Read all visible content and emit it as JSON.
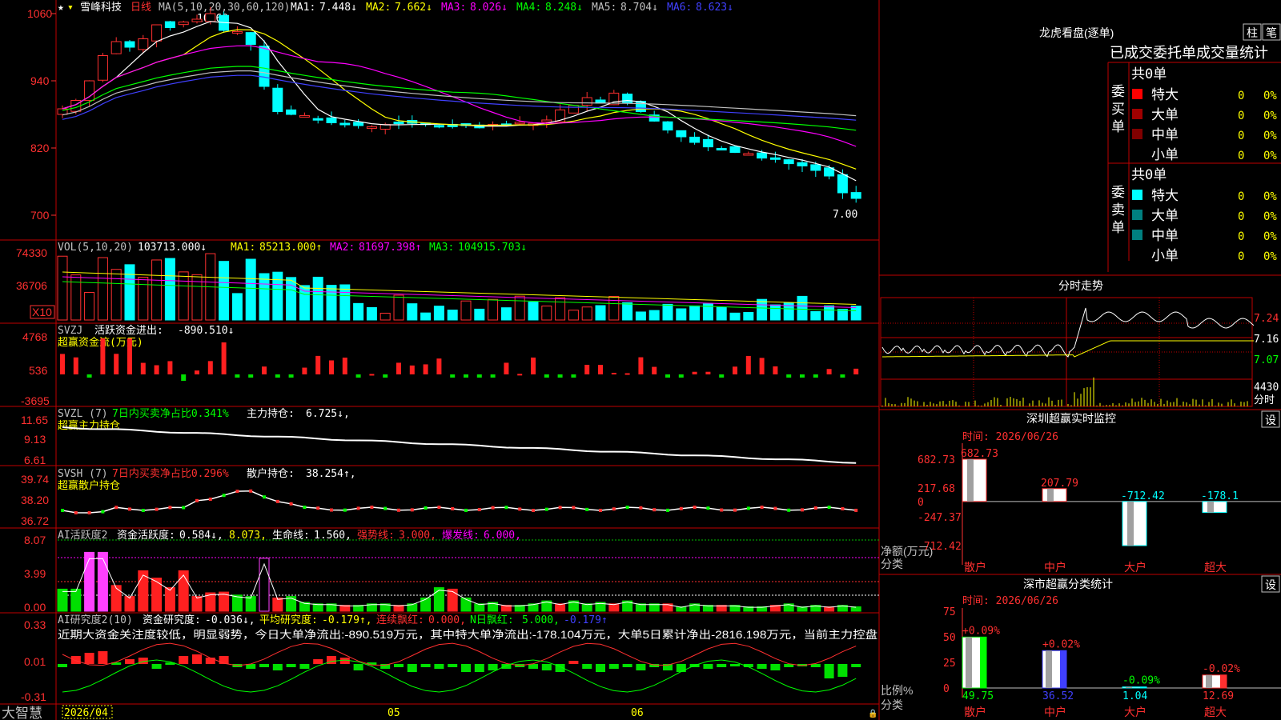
{
  "app": {
    "name": "大智慧",
    "date_label": "2026/04",
    "month_labels": [
      "05",
      "06"
    ]
  },
  "stock": {
    "name": "雪峰科技",
    "period": "日线",
    "high_marker": "10.60",
    "low_marker": "7.00",
    "ma_header": "MA(5,10,20,30,60,120)",
    "ma": [
      {
        "label": "MA1:",
        "value": "7.448↓",
        "color": "#ffffff"
      },
      {
        "label": "MA2:",
        "value": "7.662↓",
        "color": "#ffff00"
      },
      {
        "label": "MA3:",
        "value": "8.026↓",
        "color": "#ff00ff"
      },
      {
        "label": "MA4:",
        "value": "8.248↓",
        "color": "#00ff00"
      },
      {
        "label": "MA5:",
        "value": "8.704↓",
        "color": "#c0c0c0"
      },
      {
        "label": "MA6:",
        "value": "8.623↓",
        "color": "#4040ff"
      }
    ],
    "price_axis": [
      "1060",
      "940",
      "820",
      "700"
    ]
  },
  "vol": {
    "header": "VOL(5,10,20)",
    "value": "103713.000↓",
    "ma": [
      {
        "label": "MA1:",
        "value": "85213.000↑",
        "color": "#ffff00"
      },
      {
        "label": "MA2:",
        "value": "81697.398↑",
        "color": "#ff00ff"
      },
      {
        "label": "MA3:",
        "value": "104915.703↓",
        "color": "#00ff00"
      }
    ],
    "axis": [
      "74330",
      "36706"
    ],
    "unit": "X10"
  },
  "svzj": {
    "header": "SVZJ",
    "text": "活跃资金进出:",
    "value": "-890.510↓",
    "subtitle": "超赢资金流(万元)",
    "axis": [
      "4768",
      "536",
      "-3695"
    ]
  },
  "svzl": {
    "header": "SVZL (7)",
    "text": "7日内买卖净占比0.341%",
    "text2": "主力持仓:",
    "value": "6.725↓,",
    "subtitle": "超赢主力持仓",
    "axis": [
      "11.65",
      "9.13",
      "6.61"
    ]
  },
  "svsh": {
    "header": "SVSH (7)",
    "text": "7日内买卖净占比0.296%",
    "text2": "散户持仓:",
    "value": "38.254↑,",
    "subtitle": "超赢散户持仓",
    "axis": [
      "39.74",
      "38.20",
      "36.72"
    ]
  },
  "ai2": {
    "header": "AI活跃度2",
    "items": [
      {
        "text": "资金活跃度:",
        "value": "0.584↓,",
        "color": "#ffffff"
      },
      {
        "text": "",
        "value": "8.073,",
        "color": "#ffff00"
      },
      {
        "text": "生命线:",
        "value": "1.560,",
        "color": "#ffffff"
      },
      {
        "text": "强势线:",
        "value": "3.000,",
        "color": "#ff3030"
      },
      {
        "text": "爆发线:",
        "value": "6.000,",
        "color": "#ff00ff"
      }
    ],
    "axis": [
      "8.07",
      "3.99",
      "0.00"
    ]
  },
  "ai3": {
    "header": "AI研究度2(10)",
    "items": [
      {
        "text": "资金研究度:",
        "value": "-0.036↓,",
        "color": "#ffffff"
      },
      {
        "text": "平均研究度:",
        "value": "-0.179↑,",
        "color": "#ffff00"
      },
      {
        "text": "连续飘红:",
        "value": "0.000,",
        "color": "#ff3030"
      },
      {
        "text": "N日飘红:",
        "value": "5.000,",
        "color": "#00ff00"
      },
      {
        "text": "",
        "value": "-0.179↑",
        "color": "#4040ff"
      }
    ],
    "note": "近期大资金关注度较低，明显弱势，今日大单净流出:-890.519万元，其中特大单净流出:-178.104万元，大单5日累计净出-2816.198万元，当前主力控盘",
    "axis": [
      "0.33",
      "0.01",
      "-0.31"
    ]
  },
  "lhb": {
    "title": "龙虎看盘(逐单)",
    "btn1": "柱",
    "btn2": "笔",
    "tabs": "已成交委托单成交量统计",
    "buy": {
      "side": "委买单",
      "total": "共0单",
      "rows": [
        {
          "label": "特大",
          "count": "0",
          "pct": "0%",
          "color": "#ff0000"
        },
        {
          "label": "大单",
          "count": "0",
          "pct": "0%",
          "color": "#a00000"
        },
        {
          "label": "中单",
          "count": "0",
          "pct": "0%",
          "color": "#800000"
        },
        {
          "label": "小单",
          "count": "0",
          "pct": "0%",
          "color": "#000000"
        }
      ]
    },
    "sell": {
      "side": "委卖单",
      "total": "共0单",
      "rows": [
        {
          "label": "特大",
          "count": "0",
          "pct": "0%",
          "color": "#00ffff"
        },
        {
          "label": "大单",
          "count": "0",
          "pct": "0%",
          "color": "#008080"
        },
        {
          "label": "中单",
          "count": "0",
          "pct": "0%",
          "color": "#008080"
        },
        {
          "label": "小单",
          "count": "0",
          "pct": "0%",
          "color": "#000000"
        }
      ]
    }
  },
  "intraday": {
    "title": "分时走势",
    "axis": [
      "7.24",
      "7.16",
      "7.07"
    ],
    "vol_label": "4430",
    "vol_unit": "分时"
  },
  "monitor": {
    "title": "深圳超赢实时监控",
    "btn": "设",
    "time": "时间: 2026/06/26",
    "axis": [
      "682.73",
      "217.68",
      "0",
      "-247.37",
      "-712.42"
    ],
    "ylabel": "净额(万元)",
    "xlabel": "分类"
  },
  "classify": {
    "title": "深市超赢分类统计",
    "btn": "设",
    "time": "时间: 2026/06/26",
    "axis": [
      "75",
      "50",
      "25",
      "0"
    ],
    "ylabel": "比例%",
    "xlabel": "分类"
  },
  "chart_data": [
    {
      "type": "bar",
      "title": "深圳超赢实时监控",
      "ylabel": "净额(万元)",
      "xlabel": "分类",
      "categories": [
        "散户",
        "中户",
        "大户",
        "超大"
      ],
      "values": [
        682.73,
        207.79,
        -712.42,
        -178.1
      ],
      "value_labels": [
        "682.73",
        "207.79",
        "-712.42",
        "-178.1"
      ],
      "ylim": [
        -712.42,
        682.73
      ]
    },
    {
      "type": "bar",
      "title": "深市超赢分类统计",
      "ylabel": "比例%",
      "xlabel": "分类",
      "categories": [
        "散户",
        "中户",
        "大户",
        "超大"
      ],
      "values": [
        49.75,
        36.52,
        1.04,
        12.69
      ],
      "value_labels": [
        "49.75",
        "36.52",
        "1.04",
        "12.69"
      ],
      "change_labels": [
        "+0.09%",
        "+0.02%",
        "-0.09%",
        "-0.02%"
      ],
      "ylim": [
        0,
        75
      ]
    }
  ]
}
